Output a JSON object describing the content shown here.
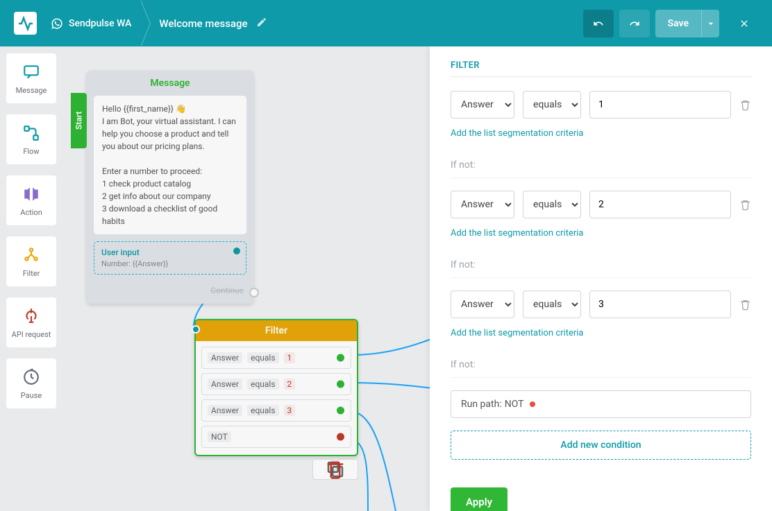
{
  "header": {
    "bot_name": "Sendpulse WA",
    "flow_name": "Welcome message",
    "save_label": "Save"
  },
  "sidebar": {
    "items": [
      {
        "label": "Message",
        "icon": "message-icon",
        "color": "#0e9aa8"
      },
      {
        "label": "Flow",
        "icon": "flow-icon",
        "color": "#0e9aa8"
      },
      {
        "label": "Action",
        "icon": "action-icon",
        "color": "#7b5cc7"
      },
      {
        "label": "Filter",
        "icon": "filter-icon",
        "color": "#e9a80a"
      },
      {
        "label": "API request",
        "icon": "api-icon",
        "color": "#c0392b"
      },
      {
        "label": "Pause",
        "icon": "pause-icon",
        "color": "#666d75"
      }
    ]
  },
  "nodes": {
    "message": {
      "start_label": "Start",
      "title": "Message",
      "body": "Hello {{first_name}} 👋\nI am Bot, your virtual assistant. I can help you choose a product and tell you about our pricing plans.\n\nEnter a number to proceed:\n1 check product catalog\n2 get info about our company\n3 download a checklist of good habits",
      "user_input_title": "User input",
      "user_input_sub": "Number: {{Answer}}",
      "continue_label": "Continue"
    },
    "filter": {
      "title": "Filter",
      "rows": [
        {
          "field": "Answer",
          "op": "equals",
          "val": "1",
          "dot": "g"
        },
        {
          "field": "Answer",
          "op": "equals",
          "val": "2",
          "dot": "g"
        },
        {
          "field": "Answer",
          "op": "equals",
          "val": "3",
          "dot": "g"
        },
        {
          "field": "NOT",
          "op": "",
          "val": "",
          "dot": "r"
        }
      ]
    }
  },
  "panel": {
    "title": "FILTER",
    "conditions": [
      {
        "field": "Answer",
        "op": "equals",
        "value": "1",
        "if_not_before": false
      },
      {
        "field": "Answer",
        "op": "equals",
        "value": "2",
        "if_not_before": true
      },
      {
        "field": "Answer",
        "op": "equals",
        "value": "3",
        "if_not_before": true
      }
    ],
    "seg_link": "Add the list segmentation criteria",
    "if_not_label": "If not:",
    "run_path_prefix": "Run path: ",
    "run_path_value": "NOT",
    "add_condition": "Add new condition",
    "apply_label": "Apply",
    "field_options": [
      "Answer"
    ],
    "op_options": [
      "equals"
    ]
  }
}
